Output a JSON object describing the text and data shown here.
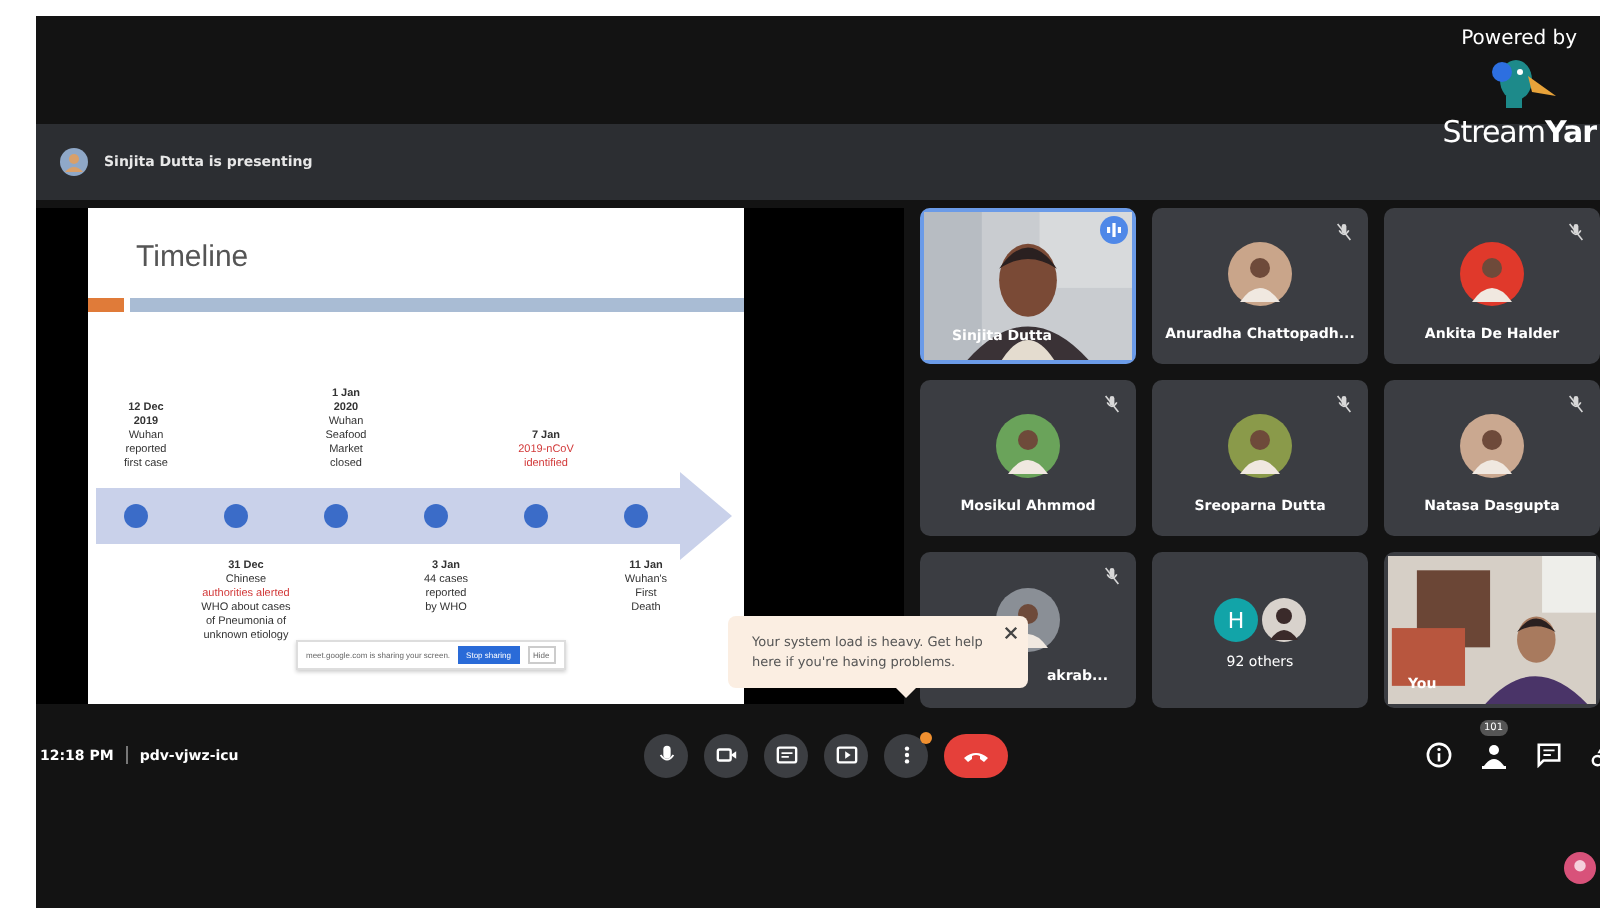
{
  "branding": {
    "caption": "Powered by",
    "wordmark_light": "Stream",
    "wordmark_bold": "Yar"
  },
  "presenter_banner": {
    "text": "Sinjita Dutta is presenting"
  },
  "slide": {
    "title": "Timeline",
    "share_notice": "meet.google.com is sharing your screen.",
    "stop_button": "Stop sharing",
    "hide_button": "Hide",
    "events": [
      {
        "kind": "above",
        "date": [
          "12 Dec",
          "2019"
        ],
        "lines": [
          {
            "text": "Wuhan",
            "red": false
          },
          {
            "text": "reported",
            "red": false
          },
          {
            "text": "first case",
            "red": false
          }
        ]
      },
      {
        "kind": "below",
        "date": [
          "31 Dec"
        ],
        "lines": [
          {
            "text": "Chinese",
            "red": false
          },
          {
            "text": "authorities alerted",
            "red": true
          },
          {
            "text": "WHO about cases",
            "red": false
          },
          {
            "text": "of Pneumonia of",
            "red": false
          },
          {
            "text": "unknown etiology",
            "red": false
          }
        ]
      },
      {
        "kind": "above",
        "date": [
          "1 Jan",
          "2020"
        ],
        "lines": [
          {
            "text": "Wuhan",
            "red": false
          },
          {
            "text": "Seafood",
            "red": false
          },
          {
            "text": "Market",
            "red": false
          },
          {
            "text": "closed",
            "red": false
          }
        ]
      },
      {
        "kind": "below",
        "date": [
          "3 Jan"
        ],
        "lines": [
          {
            "text": "44 cases",
            "red": false
          },
          {
            "text": "reported",
            "red": false
          },
          {
            "text": "by WHO",
            "red": false
          }
        ]
      },
      {
        "kind": "above",
        "date": [
          "7 Jan"
        ],
        "lines": [
          {
            "text": "2019-nCoV",
            "red": true
          },
          {
            "text": "identified",
            "red": true
          }
        ]
      },
      {
        "kind": "below",
        "date": [
          "11 Jan"
        ],
        "lines": [
          {
            "text": "Wuhan's",
            "red": false
          },
          {
            "text": "First",
            "red": false
          },
          {
            "text": "Death",
            "red": false
          }
        ]
      }
    ]
  },
  "tiles": [
    {
      "kind": "video",
      "name": "Sinjita Dutta",
      "speaking": true,
      "muted": false
    },
    {
      "kind": "avatar",
      "name": "Anuradha Chattopadh...",
      "speaking": false,
      "muted": true,
      "color": "#c9a58a"
    },
    {
      "kind": "avatar",
      "name": "Ankita De Halder",
      "speaking": false,
      "muted": true,
      "color": "#e0392b"
    },
    {
      "kind": "avatar",
      "name": "Mosikul Ahmmod",
      "speaking": false,
      "muted": true,
      "color": "#6aa35a"
    },
    {
      "kind": "avatar",
      "name": "Sreoparna Dutta",
      "speaking": false,
      "muted": true,
      "color": "#8a9a4a"
    },
    {
      "kind": "avatar",
      "name": "Natasa Dasgupta",
      "speaking": false,
      "muted": true,
      "color": "#caa890"
    },
    {
      "kind": "covered",
      "name": "akrab...",
      "speaking": false,
      "muted": true,
      "color": "#8a8f96"
    },
    {
      "kind": "others",
      "initial": "H",
      "name": "92 others",
      "speaking": false,
      "muted": false
    },
    {
      "kind": "self",
      "name": "You",
      "speaking": false,
      "muted": false
    }
  ],
  "notice": {
    "text": "Your system load is heavy. Get help here if you're having problems."
  },
  "bottom_bar": {
    "time": "12:18 PM",
    "meeting_code": "pdv-vjwz-icu",
    "participant_count": "101"
  }
}
